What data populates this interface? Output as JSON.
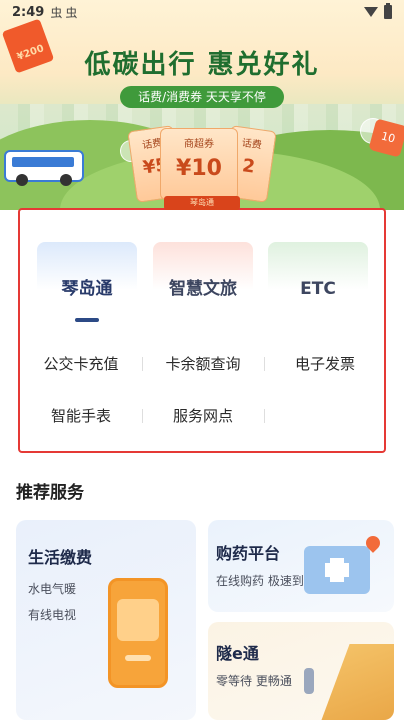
{
  "status_bar": {
    "time": "2:49",
    "notifications": [
      "虫",
      "虫"
    ]
  },
  "banner": {
    "title": "低碳出行 惠兑好礼",
    "pill": "话费/消费券 天天享不停",
    "coupon_left_title": "话费",
    "coupon_left_value": "¥5",
    "coupon_mid_title": "商超券",
    "coupon_mid_value": "¥10",
    "coupon_right_title": "话费",
    "coupon_right_value": "2",
    "coupon_footer": "琴岛通",
    "red_packet_value": "¥200",
    "tag_value": "10",
    "colors": {
      "title": "#1f6e2f",
      "pill": "#3f9a3b",
      "coupon": "#c94a1c"
    }
  },
  "menu": {
    "tabs": [
      {
        "label": "琴岛通",
        "active": true
      },
      {
        "label": "智慧文旅",
        "active": false
      },
      {
        "label": "ETC",
        "active": false
      }
    ],
    "items": [
      {
        "label": "公交卡充值"
      },
      {
        "label": "卡余额查询"
      },
      {
        "label": "电子发票"
      },
      {
        "label": "智能手表"
      },
      {
        "label": "服务网点"
      }
    ],
    "highlight_color": "#e53935",
    "active_color": "#2c4a86"
  },
  "recommended": {
    "title": "推荐服务",
    "life": {
      "title": "生活缴费",
      "line1": "水电气暖",
      "line2": "有线电视",
      "icon": "phone-payment-icon"
    },
    "drug": {
      "title": "购药平台",
      "subtitle": "在线购药 极速到家",
      "icon": "medical-kit-icon"
    },
    "tunnel": {
      "title": "隧e通",
      "subtitle": "零等待 更畅通",
      "icon": "road-icon"
    }
  }
}
